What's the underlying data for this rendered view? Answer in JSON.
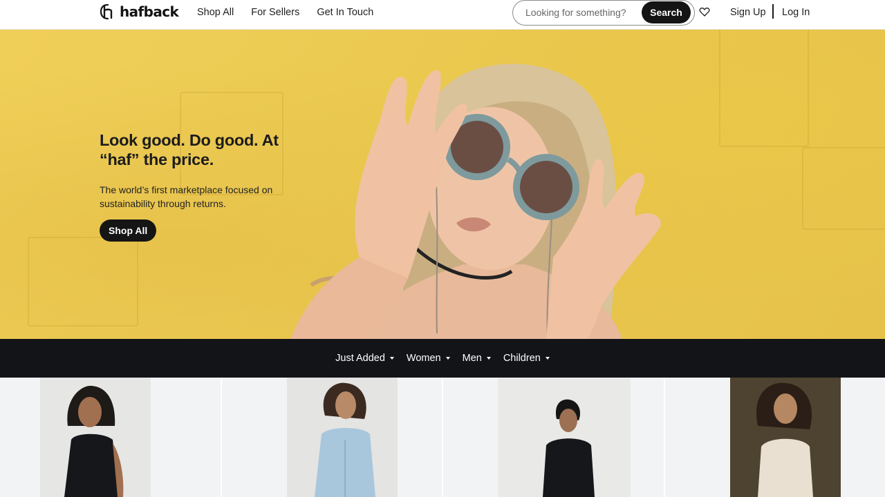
{
  "header": {
    "logo_text": "hafback",
    "nav": [
      "Shop All",
      "For Sellers",
      "Get In Touch"
    ],
    "search_placeholder": "Looking for something?",
    "search_button": "Search",
    "signup": "Sign Up",
    "login": "Log In"
  },
  "hero": {
    "title": "Look good. Do good. At “haf” the price.",
    "subtitle": "The world’s first marketplace focused on sustainability through returns.",
    "cta": "Shop All"
  },
  "categories": [
    "Just Added",
    "Women",
    "Men",
    "Children"
  ],
  "colors": {
    "hero_bg": "#ecc951",
    "dark": "#131418",
    "card_bg": "#f2f3f4"
  },
  "icons": [
    "logo-mark-icon",
    "heart-icon",
    "caret-down-icon"
  ]
}
